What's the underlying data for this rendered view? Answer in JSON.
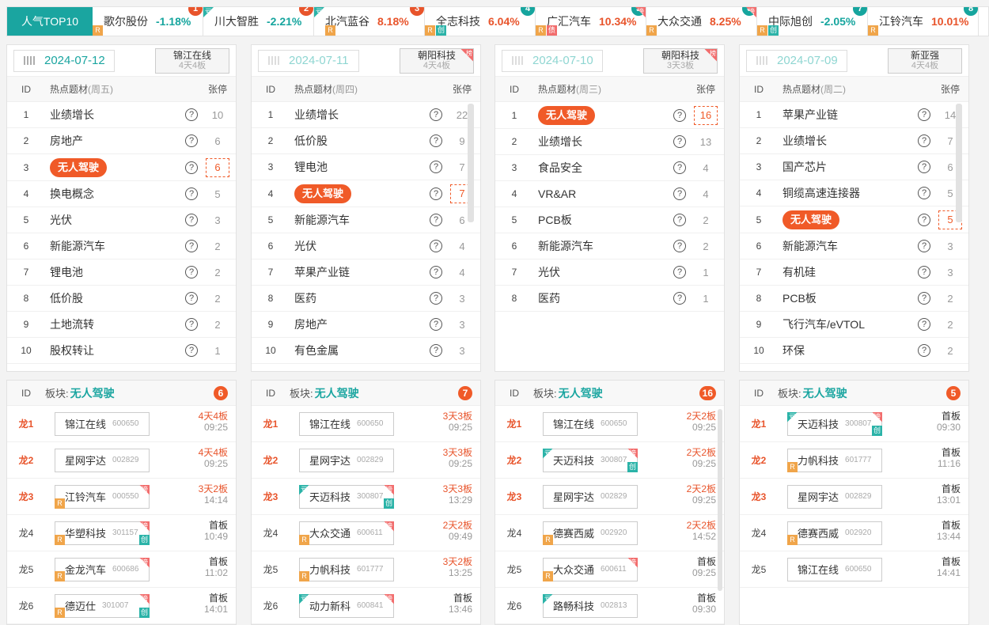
{
  "top10": {
    "title": "人气TOP10",
    "items": [
      {
        "rank": "1",
        "name": "歌尔股份",
        "pct": "-1.18%",
        "dir": "neg",
        "rank_color": "r",
        "flags": [
          "R"
        ]
      },
      {
        "rank": "2",
        "name": "川大智胜",
        "pct": "-2.21%",
        "dir": "neg",
        "rank_color": "r",
        "flags": [
          "K"
        ]
      },
      {
        "rank": "3",
        "name": "北汽蓝谷",
        "pct": "8.18%",
        "dir": "pos",
        "rank_color": "r",
        "flags": [
          "K",
          "R"
        ]
      },
      {
        "rank": "4",
        "name": "全志科技",
        "pct": "6.04%",
        "dir": "pos",
        "rank_color": "t",
        "flags": [
          "R",
          "C"
        ]
      },
      {
        "rank": "5",
        "name": "广汇汽车",
        "pct": "10.34%",
        "dir": "pos",
        "rank_color": "t",
        "flags": [
          "R",
          "B",
          "L"
        ]
      },
      {
        "rank": "6",
        "name": "大众交通",
        "pct": "8.25%",
        "dir": "pos",
        "rank_color": "t",
        "flags": [
          "R",
          "L"
        ]
      },
      {
        "rank": "7",
        "name": "中际旭创",
        "pct": "-2.05%",
        "dir": "neg",
        "rank_color": "t",
        "flags": [
          "R",
          "C"
        ]
      },
      {
        "rank": "8",
        "name": "江铃汽车",
        "pct": "10.01%",
        "dir": "pos",
        "rank_color": "t",
        "flags": [
          "R"
        ]
      }
    ]
  },
  "labels": {
    "id": "ID",
    "topic": "热点题材",
    "zt": "张停",
    "sector": "板块:"
  },
  "flag_text": {
    "R": "R",
    "C": "创",
    "B": "债",
    "K": "亏",
    "L": "榜"
  },
  "panels": [
    {
      "date": "2024-07-12",
      "dim": false,
      "leader": {
        "name": "锦江在线",
        "streak": "4天4板",
        "bang": false
      },
      "weekday": "(周五)",
      "scroll": false,
      "rows": [
        [
          "1",
          "业绩增长",
          "10"
        ],
        [
          "2",
          "房地产",
          "6"
        ],
        [
          "3",
          "无人驾驶",
          "6"
        ],
        [
          "4",
          "换电概念",
          "5"
        ],
        [
          "5",
          "光伏",
          "3"
        ],
        [
          "6",
          "新能源汽车",
          "2"
        ],
        [
          "7",
          "锂电池",
          "2"
        ],
        [
          "8",
          "低价股",
          "2"
        ],
        [
          "9",
          "土地流转",
          "2"
        ],
        [
          "10",
          "股权转让",
          "1"
        ]
      ],
      "hl_index": 2,
      "sector": "无人驾驶",
      "count": "6",
      "stocks": [
        {
          "lbl": "龙1",
          "hot": true,
          "name": "锦江在线",
          "code": "600650",
          "stage": "4天4板",
          "up": true,
          "time": "09:25",
          "flags": []
        },
        {
          "lbl": "龙2",
          "hot": true,
          "name": "星网宇达",
          "code": "002829",
          "stage": "4天4板",
          "up": true,
          "time": "09:25",
          "flags": []
        },
        {
          "lbl": "龙3",
          "hot": true,
          "name": "江铃汽车",
          "code": "000550",
          "stage": "3天2板",
          "up": true,
          "time": "14:14",
          "flags": [
            "R",
            "L"
          ]
        },
        {
          "lbl": "龙4",
          "hot": false,
          "name": "华塑科技",
          "code": "301157",
          "stage": "首板",
          "up": false,
          "time": "10:49",
          "flags": [
            "R",
            "L",
            "C"
          ]
        },
        {
          "lbl": "龙5",
          "hot": false,
          "name": "金龙汽车",
          "code": "600686",
          "stage": "首板",
          "up": false,
          "time": "11:02",
          "flags": [
            "R",
            "L"
          ]
        },
        {
          "lbl": "龙6",
          "hot": false,
          "name": "德迈仕",
          "code": "301007",
          "stage": "首板",
          "up": false,
          "time": "14:01",
          "flags": [
            "R",
            "L",
            "C"
          ]
        }
      ]
    },
    {
      "date": "2024-07-11",
      "dim": true,
      "leader": {
        "name": "朝阳科技",
        "streak": "4天4板",
        "bang": true
      },
      "weekday": "(周四)",
      "scroll": true,
      "rows": [
        [
          "1",
          "业绩增长",
          "22"
        ],
        [
          "2",
          "低价股",
          "9"
        ],
        [
          "3",
          "锂电池",
          "7"
        ],
        [
          "4",
          "无人驾驶",
          "7"
        ],
        [
          "5",
          "新能源汽车",
          "6"
        ],
        [
          "6",
          "光伏",
          "4"
        ],
        [
          "7",
          "苹果产业链",
          "4"
        ],
        [
          "8",
          "医药",
          "3"
        ],
        [
          "9",
          "房地产",
          "3"
        ],
        [
          "10",
          "有色金属",
          "3"
        ]
      ],
      "hl_index": 3,
      "sector": "无人驾驶",
      "count": "7",
      "stocks": [
        {
          "lbl": "龙1",
          "hot": true,
          "name": "锦江在线",
          "code": "600650",
          "stage": "3天3板",
          "up": true,
          "time": "09:25",
          "flags": []
        },
        {
          "lbl": "龙2",
          "hot": true,
          "name": "星网宇达",
          "code": "002829",
          "stage": "3天3板",
          "up": true,
          "time": "09:25",
          "flags": []
        },
        {
          "lbl": "龙3",
          "hot": true,
          "name": "天迈科技",
          "code": "300807",
          "stage": "3天3板",
          "up": true,
          "time": "13:29",
          "flags": [
            "K",
            "L",
            "C"
          ]
        },
        {
          "lbl": "龙4",
          "hot": false,
          "name": "大众交通",
          "code": "600611",
          "stage": "2天2板",
          "up": true,
          "time": "09:49",
          "flags": [
            "R",
            "L"
          ]
        },
        {
          "lbl": "龙5",
          "hot": false,
          "name": "力帆科技",
          "code": "601777",
          "stage": "3天2板",
          "up": true,
          "time": "13:25",
          "flags": [
            "R"
          ]
        },
        {
          "lbl": "龙6",
          "hot": false,
          "name": "动力新科",
          "code": "600841",
          "stage": "首板",
          "up": false,
          "time": "13:46",
          "flags": [
            "K",
            "L"
          ]
        }
      ]
    },
    {
      "date": "2024-07-10",
      "dim": true,
      "leader": {
        "name": "朝阳科技",
        "streak": "3天3板",
        "bang": true
      },
      "weekday": "(周三)",
      "scroll": false,
      "rows": [
        [
          "1",
          "无人驾驶",
          "16"
        ],
        [
          "2",
          "业绩增长",
          "13"
        ],
        [
          "3",
          "食品安全",
          "4"
        ],
        [
          "4",
          "VR&AR",
          "4"
        ],
        [
          "5",
          "PCB板",
          "2"
        ],
        [
          "6",
          "新能源汽车",
          "2"
        ],
        [
          "7",
          "光伏",
          "1"
        ],
        [
          "8",
          "医药",
          "1"
        ]
      ],
      "hl_index": 0,
      "sector": "无人驾驶",
      "count": "16",
      "stocks": [
        {
          "lbl": "龙1",
          "hot": true,
          "name": "锦江在线",
          "code": "600650",
          "stage": "2天2板",
          "up": true,
          "time": "09:25",
          "flags": []
        },
        {
          "lbl": "龙2",
          "hot": true,
          "name": "天迈科技",
          "code": "300807",
          "stage": "2天2板",
          "up": true,
          "time": "09:25",
          "flags": [
            "K",
            "L",
            "C"
          ]
        },
        {
          "lbl": "龙3",
          "hot": true,
          "name": "星网宇达",
          "code": "002829",
          "stage": "2天2板",
          "up": true,
          "time": "09:25",
          "flags": []
        },
        {
          "lbl": "龙4",
          "hot": false,
          "name": "德赛西威",
          "code": "002920",
          "stage": "2天2板",
          "up": true,
          "time": "14:52",
          "flags": [
            "R"
          ]
        },
        {
          "lbl": "龙5",
          "hot": false,
          "name": "大众交通",
          "code": "600611",
          "stage": "首板",
          "up": false,
          "time": "09:25",
          "flags": [
            "R",
            "L"
          ]
        },
        {
          "lbl": "龙6",
          "hot": false,
          "name": "路畅科技",
          "code": "002813",
          "stage": "首板",
          "up": false,
          "time": "09:30",
          "flags": [
            "K"
          ]
        }
      ]
    },
    {
      "date": "2024-07-09",
      "dim": true,
      "leader": {
        "name": "新亚强",
        "streak": "4天4板",
        "bang": false
      },
      "weekday": "(周二)",
      "scroll": true,
      "rows": [
        [
          "1",
          "苹果产业链",
          "14"
        ],
        [
          "2",
          "业绩增长",
          "7"
        ],
        [
          "3",
          "国产芯片",
          "6"
        ],
        [
          "4",
          "铜缆高速连接器",
          "5"
        ],
        [
          "5",
          "无人驾驶",
          "5"
        ],
        [
          "6",
          "新能源汽车",
          "3"
        ],
        [
          "7",
          "有机硅",
          "3"
        ],
        [
          "8",
          "PCB板",
          "2"
        ],
        [
          "9",
          "飞行汽车/eVTOL",
          "2"
        ],
        [
          "10",
          "环保",
          "2"
        ]
      ],
      "hl_index": 4,
      "sector": "无人驾驶",
      "count": "5",
      "stocks": [
        {
          "lbl": "龙1",
          "hot": true,
          "name": "天迈科技",
          "code": "300807",
          "stage": "首板",
          "up": false,
          "time": "09:30",
          "flags": [
            "K",
            "L",
            "C"
          ]
        },
        {
          "lbl": "龙2",
          "hot": true,
          "name": "力帆科技",
          "code": "601777",
          "stage": "首板",
          "up": false,
          "time": "11:16",
          "flags": [
            "R"
          ]
        },
        {
          "lbl": "龙3",
          "hot": true,
          "name": "星网宇达",
          "code": "002829",
          "stage": "首板",
          "up": false,
          "time": "13:01",
          "flags": []
        },
        {
          "lbl": "龙4",
          "hot": false,
          "name": "德赛西威",
          "code": "002920",
          "stage": "首板",
          "up": false,
          "time": "13:44",
          "flags": [
            "R"
          ]
        },
        {
          "lbl": "龙5",
          "hot": false,
          "name": "锦江在线",
          "code": "600650",
          "stage": "首板",
          "up": false,
          "time": "14:41",
          "flags": []
        }
      ]
    }
  ]
}
